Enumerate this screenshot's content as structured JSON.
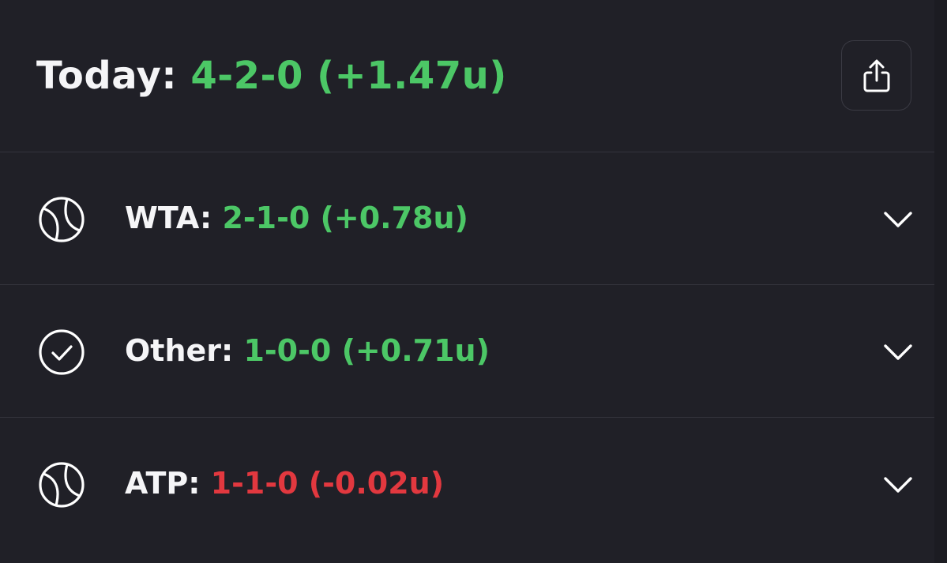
{
  "header": {
    "title_label": "Today:",
    "record": "4-2-0 (+1.47u)",
    "record_color": "#4cc766",
    "share_icon": "share-icon"
  },
  "rows": [
    {
      "icon": "tennis-ball-icon",
      "label": "WTA:",
      "record": "2-1-0 (+0.78u)",
      "status": "positive",
      "expand_icon": "chevron-down-icon"
    },
    {
      "icon": "check-circle-icon",
      "label": "Other:",
      "record": "1-0-0 (+0.71u)",
      "status": "positive",
      "expand_icon": "chevron-down-icon"
    },
    {
      "icon": "tennis-ball-icon",
      "label": "ATP:",
      "record": "1-1-0 (-0.02u)",
      "status": "negative",
      "expand_icon": "chevron-down-icon"
    }
  ],
  "colors": {
    "background": "#202027",
    "positive": "#4cc766",
    "negative": "#e2383f",
    "text": "#f5f5f7",
    "divider": "#34343c"
  }
}
